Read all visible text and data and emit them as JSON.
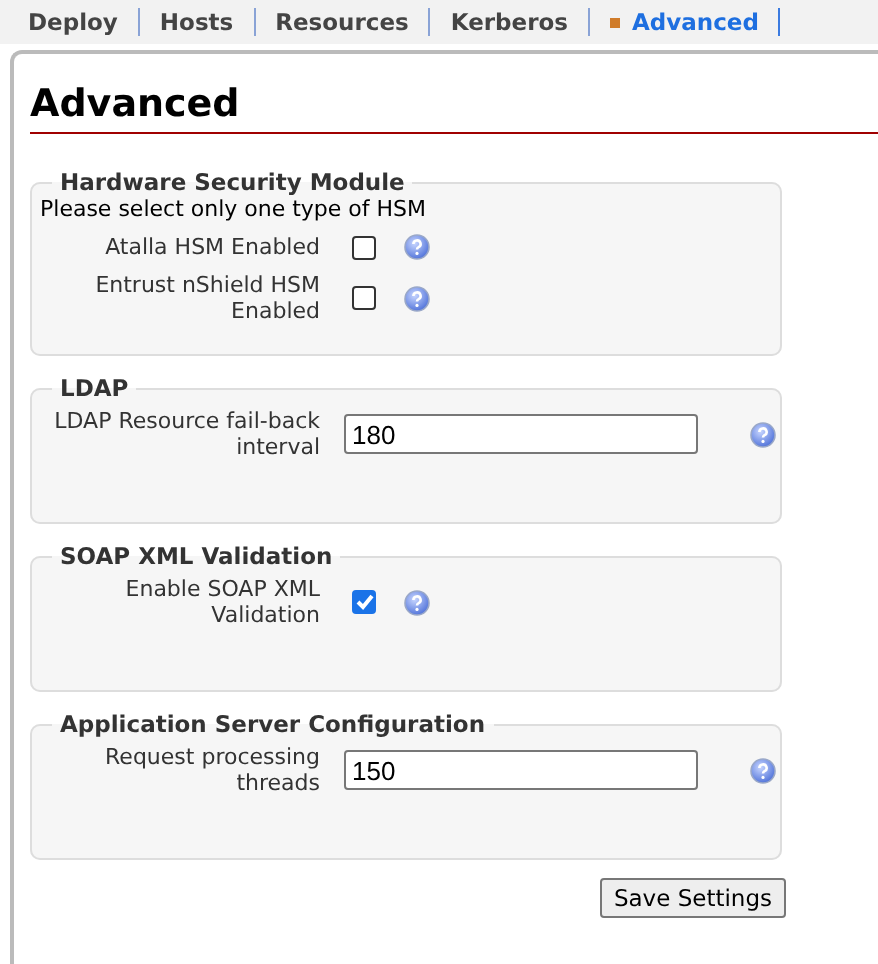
{
  "tabs": [
    {
      "label": "Deploy",
      "selected": false
    },
    {
      "label": "Hosts",
      "selected": false
    },
    {
      "label": "Resources",
      "selected": false
    },
    {
      "label": "Kerberos",
      "selected": false
    },
    {
      "label": "Advanced",
      "selected": true
    }
  ],
  "page_title": "Advanced",
  "sections": [
    {
      "legend": "Hardware Security Module",
      "note": "Please select only one type of HSM",
      "fields": [
        {
          "kind": "checkbox",
          "label": "Atalla HSM Enabled",
          "checked": false
        },
        {
          "kind": "checkbox",
          "label": "Entrust nShield HSM Enabled",
          "checked": false
        }
      ]
    },
    {
      "legend": "LDAP",
      "fields": [
        {
          "kind": "text",
          "label": "LDAP Resource fail-back interval",
          "value": "180"
        }
      ]
    },
    {
      "legend": "SOAP XML Validation",
      "fields": [
        {
          "kind": "checkbox",
          "label": "Enable SOAP XML Validation",
          "checked": true
        }
      ]
    },
    {
      "legend": "Application Server Configuration",
      "fields": [
        {
          "kind": "text",
          "label": "Request processing threads",
          "value": "150"
        }
      ]
    }
  ],
  "save_button": "Save Settings"
}
